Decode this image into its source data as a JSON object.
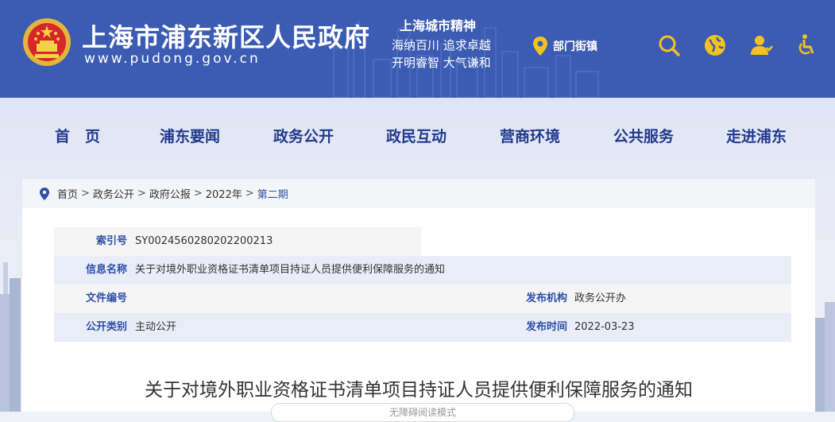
{
  "header": {
    "title": "上海市浦东新区人民政府",
    "url": "www.pudong.gov.cn",
    "spirit_title": "上海城市精神",
    "spirit_line1": "海纳百川   追求卓越",
    "spirit_line2": "开明睿智   大气谦和",
    "dept_link": "部门街镇",
    "bg_color": "#3c5cb4",
    "icons": [
      "search-icon",
      "globe-icon",
      "user-icon",
      "accessibility-icon"
    ]
  },
  "nav": {
    "items": [
      "首　页",
      "浦东要闻",
      "政务公开",
      "政民互动",
      "营商环境",
      "公共服务",
      "走进浦东"
    ],
    "text_color": "#223a8c"
  },
  "breadcrumb": {
    "items": [
      "首页",
      "政务公开",
      "政府公报",
      "2022年"
    ],
    "current": "第二期",
    "separator": ">"
  },
  "meta": {
    "index_label": "索引号",
    "index_value": "SY0024560280202200213",
    "info_label": "信息名称",
    "info_value": "关于对境外职业资格证书清单项目持证人员提供便利保障服务的通知",
    "docno_label": "文件编号",
    "docno_value": "",
    "issuer_label": "发布机构",
    "issuer_value": "政务公开办",
    "category_label": "公开类别",
    "category_value": "主动公开",
    "date_label": "发布时间",
    "date_value": "2022-03-23"
  },
  "document": {
    "title": "关于对境外职业资格证书清单项目持证人员提供便利保障服务的通知",
    "reader_tool": "无障碍阅读模式"
  }
}
